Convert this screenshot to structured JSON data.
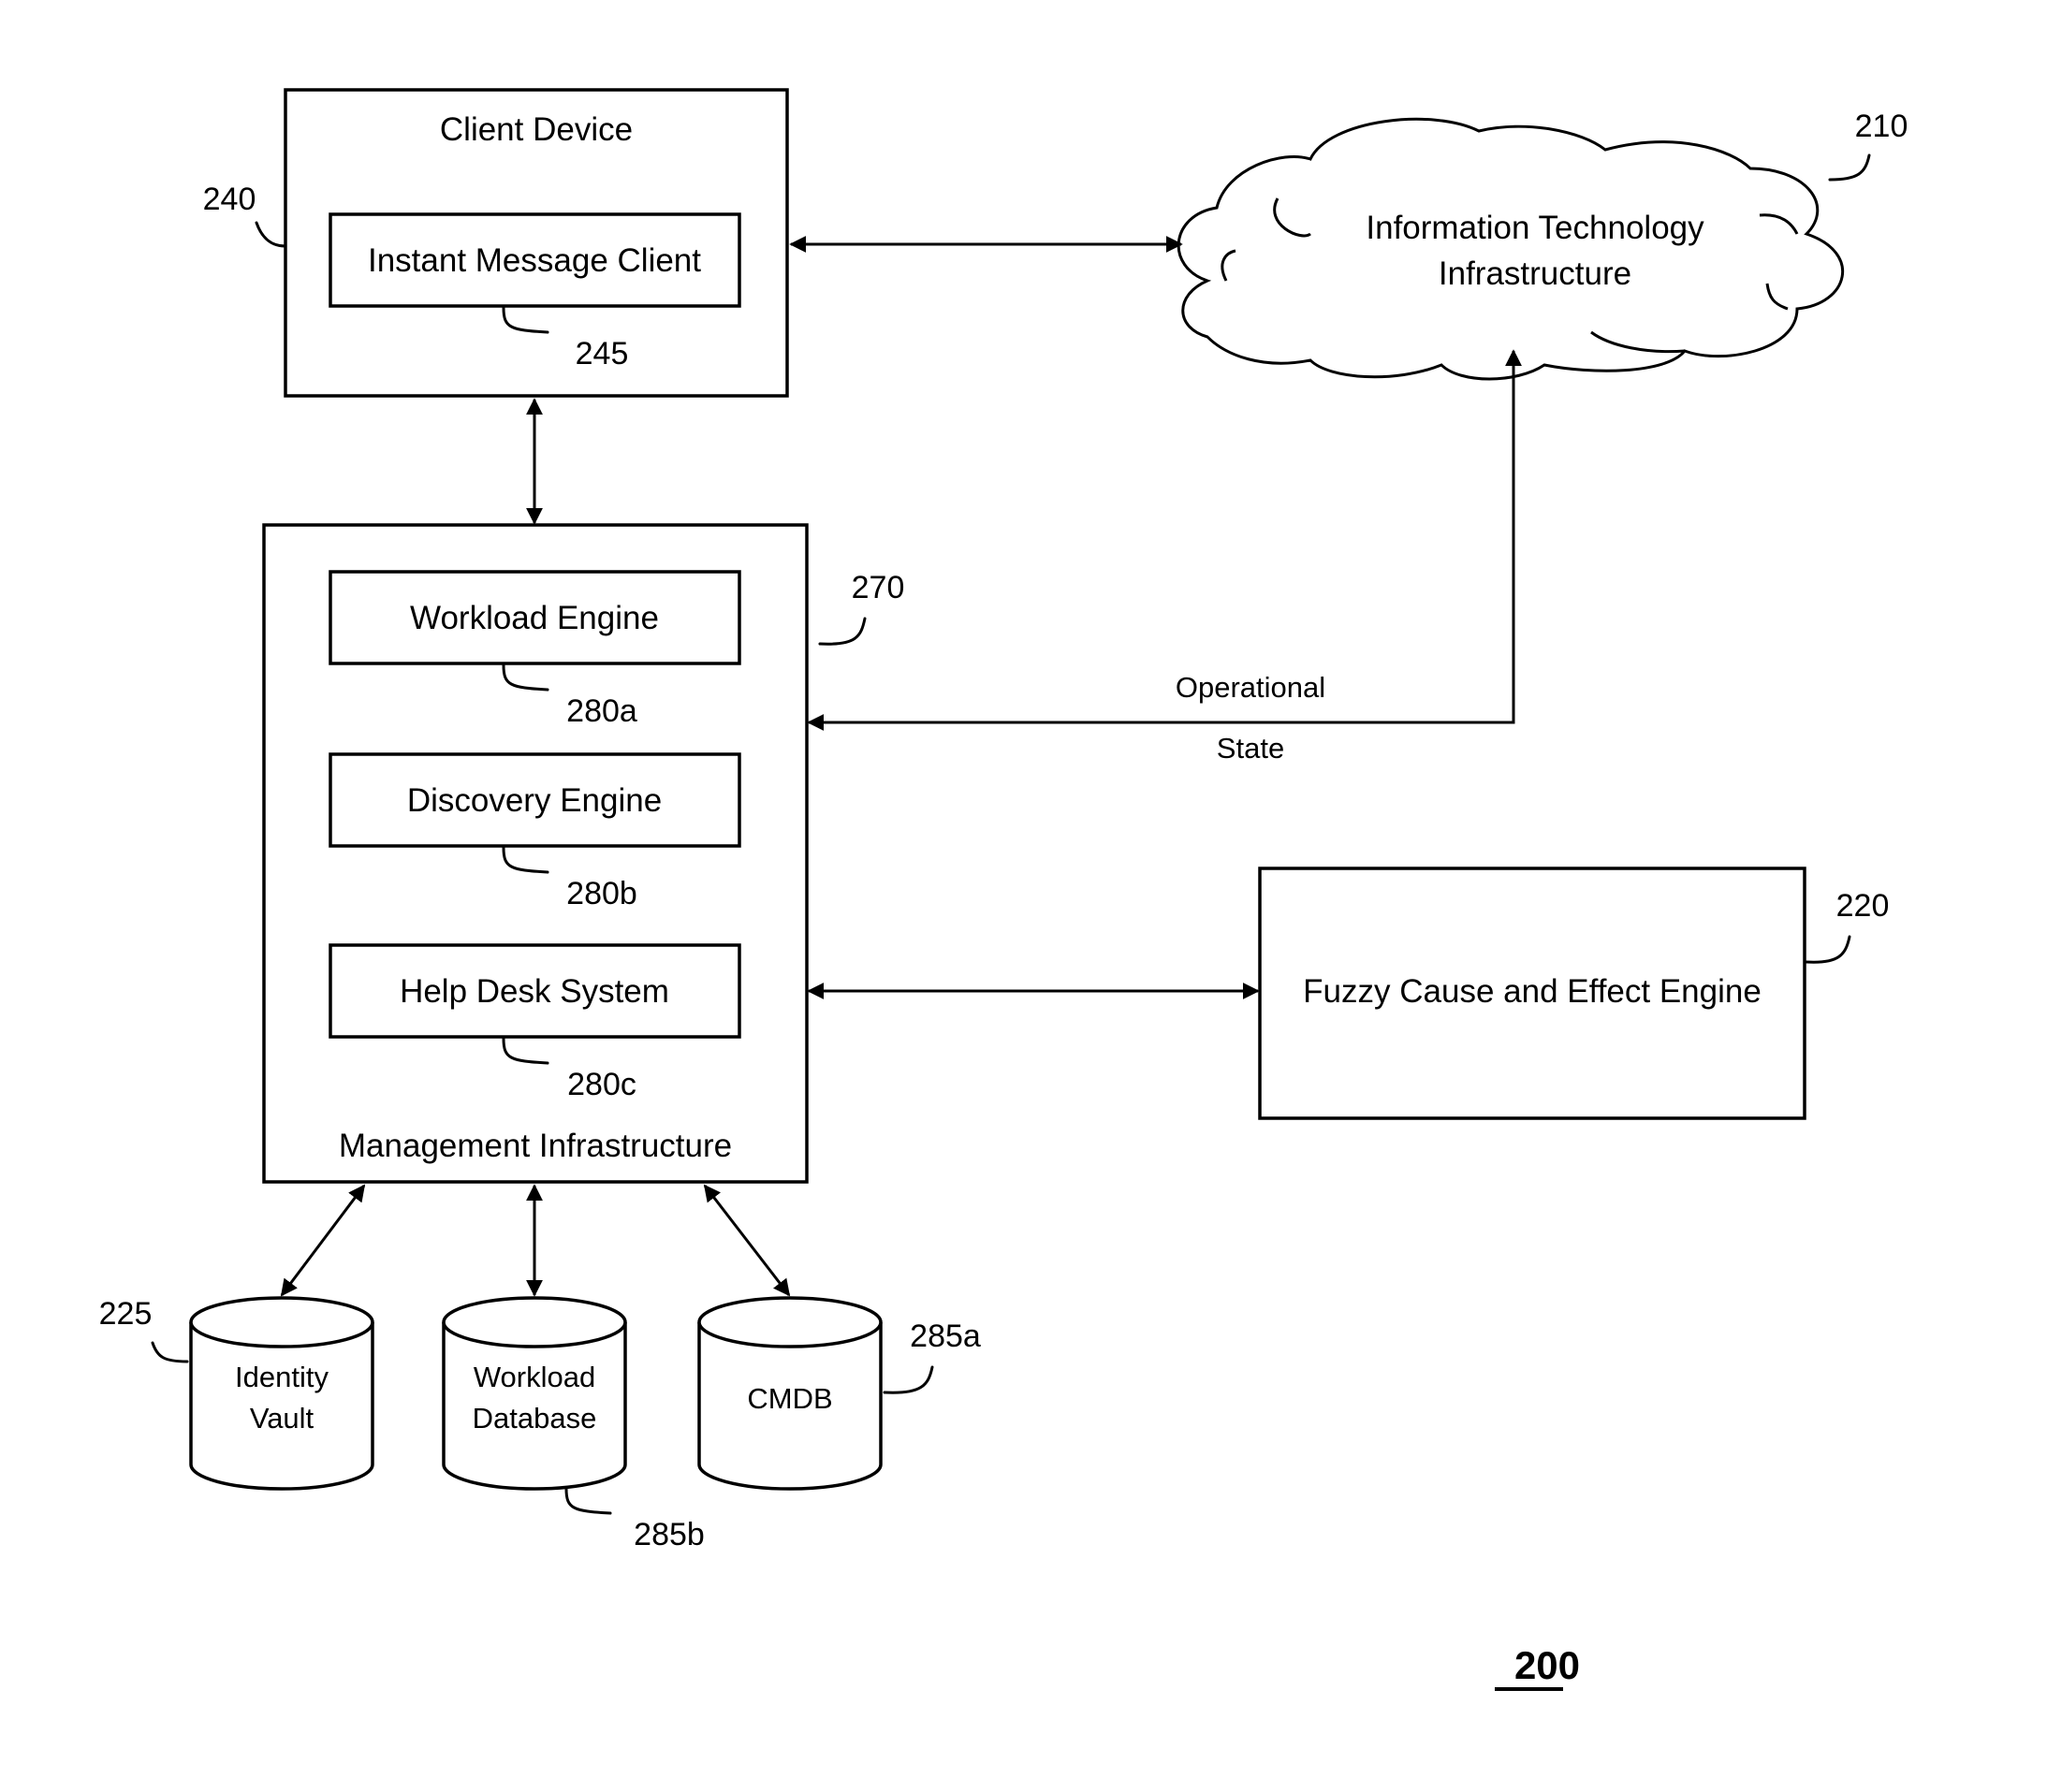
{
  "figure": {
    "number": "200"
  },
  "client_device": {
    "title": "Client Device",
    "ref": "240",
    "instant_message_client": {
      "label": "Instant Message Client",
      "ref": "245"
    }
  },
  "it_infrastructure": {
    "line1": "Information Technology",
    "line2": "Infrastructure",
    "ref": "210"
  },
  "management_infrastructure": {
    "title": "Management Infrastructure",
    "ref": "270",
    "components": [
      {
        "label": "Workload Engine",
        "ref": "280a"
      },
      {
        "label": "Discovery Engine",
        "ref": "280b"
      },
      {
        "label": "Help Desk System",
        "ref": "280c"
      }
    ]
  },
  "operational_state": {
    "line1": "Operational",
    "line2": "State"
  },
  "fuzzy_engine": {
    "label": "Fuzzy Cause and Effect Engine",
    "ref": "220"
  },
  "databases": [
    {
      "line1": "Identity",
      "line2": "Vault",
      "ref": "225"
    },
    {
      "line1": "Workload",
      "line2": "Database",
      "ref": "285b"
    },
    {
      "line1": "CMDB",
      "line2": "",
      "ref": "285a"
    }
  ],
  "colors": {
    "stroke": "#000000",
    "background": "#ffffff"
  }
}
